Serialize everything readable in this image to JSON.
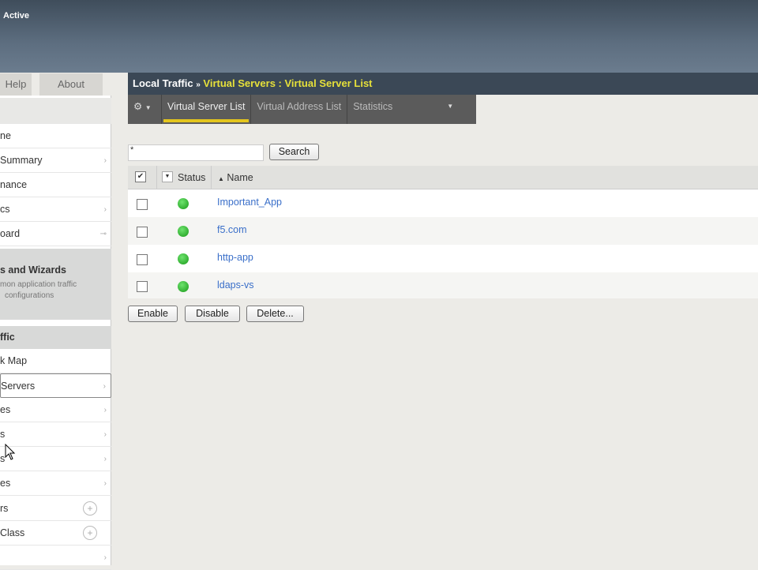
{
  "header": {
    "status": "Active"
  },
  "top_tabs": [
    "Help",
    "About"
  ],
  "sidebar": {
    "items_top": [
      {
        "label": "ne",
        "chev": false
      },
      {
        "label": "Summary",
        "chev": true
      },
      {
        "label": "nance",
        "chev": false
      },
      {
        "label": "cs",
        "chev": true
      },
      {
        "label": "oard",
        "chev": false
      }
    ],
    "wizards": {
      "title": "s and Wizards",
      "desc1": "mon application traffic",
      "desc2": "configurations"
    },
    "section": "ffic",
    "items": [
      {
        "label": "k Map"
      },
      {
        "label": "Servers"
      },
      {
        "label": "es"
      },
      {
        "label": "s"
      },
      {
        "label": "s"
      },
      {
        "label": "es"
      },
      {
        "label": "rs"
      },
      {
        "label": "Class"
      },
      {
        "label": ""
      }
    ]
  },
  "breadcrumb": {
    "root": "Local Traffic",
    "sep": "»",
    "path": "Virtual Servers : Virtual Server List"
  },
  "tabs": [
    "Virtual Server List",
    "Virtual Address List",
    "Statistics"
  ],
  "search": {
    "value": "*",
    "button": "Search"
  },
  "table": {
    "headers": {
      "status": "Status",
      "name": "Name"
    },
    "rows": [
      {
        "name": "Important_App",
        "status": "green"
      },
      {
        "name": "f5.com",
        "status": "green"
      },
      {
        "name": "http-app",
        "status": "green"
      },
      {
        "name": "ldaps-vs",
        "status": "green"
      }
    ]
  },
  "actions": [
    "Enable",
    "Disable",
    "Delete..."
  ]
}
